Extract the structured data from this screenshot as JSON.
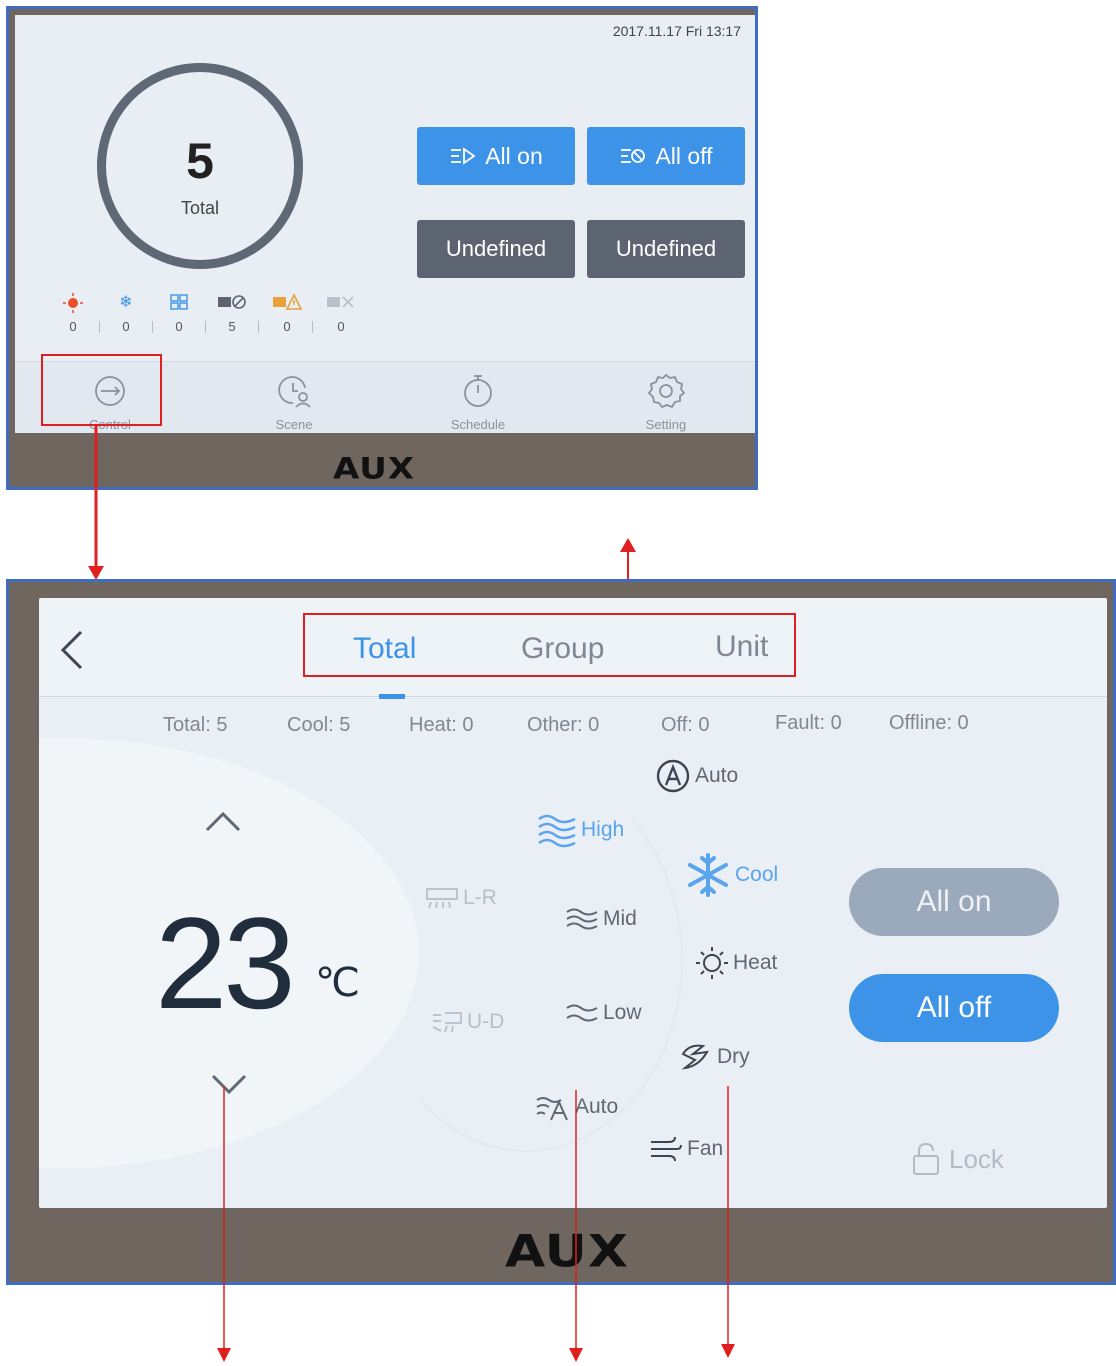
{
  "screen1": {
    "datetime": "2017.11.17 Fri 13:17",
    "total_count": "5",
    "total_label": "Total",
    "buttons": {
      "all_on": "All on",
      "all_off": "All off",
      "undefined1": "Undefined",
      "undefined2": "Undefined"
    },
    "status": [
      {
        "icon": "sun-icon",
        "value": "0"
      },
      {
        "icon": "snowflake-icon",
        "value": "0"
      },
      {
        "icon": "grid-icon",
        "value": "0"
      },
      {
        "icon": "unit-off-icon",
        "value": "5"
      },
      {
        "icon": "unit-fault-icon",
        "value": "0"
      },
      {
        "icon": "unit-offline-icon",
        "value": "0"
      }
    ],
    "nav": [
      {
        "label": "Control"
      },
      {
        "label": "Scene"
      },
      {
        "label": "Schedule"
      },
      {
        "label": "Setting"
      }
    ],
    "brand": "AUX"
  },
  "screen2": {
    "tabs": [
      "Total",
      "Group",
      "Unit"
    ],
    "stats": [
      "Total: 5",
      "Cool: 5",
      "Heat: 0",
      "Other: 0",
      "Off: 0",
      "Fault: 0",
      "Offline: 0"
    ],
    "temperature": "23",
    "temperature_unit": "℃",
    "swing": {
      "lr": "L-R",
      "ud": "U-D"
    },
    "fan_speed": {
      "high": "High",
      "mid": "Mid",
      "low": "Low",
      "auto": "Auto"
    },
    "modes": {
      "auto": "Auto",
      "cool": "Cool",
      "heat": "Heat",
      "dry": "Dry",
      "fan": "Fan"
    },
    "buttons": {
      "all_on": "All on",
      "all_off": "All off"
    },
    "lock": "Lock",
    "brand": "AUX"
  },
  "colors": {
    "accent": "#3d93e8",
    "annotation": "#e02020",
    "frame_border": "#3f6cc0"
  }
}
